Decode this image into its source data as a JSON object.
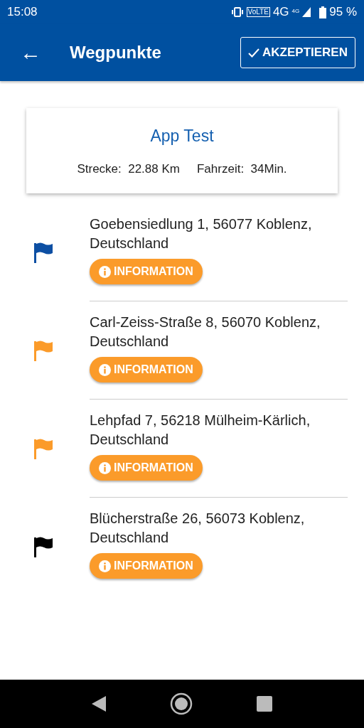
{
  "status_bar": {
    "time": "15:08",
    "network_badge": "VoLTE",
    "network_type": "4G",
    "signal_type": "4G",
    "battery": "95 %"
  },
  "app_bar": {
    "back": "←",
    "title": "Wegpunkte",
    "accept_button": "AKZEPTIEREN"
  },
  "summary": {
    "title": "App Test",
    "distance_label": "Strecke:",
    "distance": "22.88 Km",
    "duration_label": "Fahrzeit:",
    "duration": "34Min."
  },
  "waypoints": [
    {
      "address": "Goebensiedlung 1, 56077 Koblenz, Deutschland",
      "color": "#0d4fa3",
      "button": "INFORMATION"
    },
    {
      "address": "Carl-Zeiss-Straße 8, 56070 Koblenz, Deutschland",
      "color": "#fb9b2a",
      "button": "INFORMATION"
    },
    {
      "address": "Lehpfad 7, 56218 Mülheim-Kärlich, Deutschland",
      "color": "#fb9b2a",
      "button": "INFORMATION"
    },
    {
      "address": "Blücherstraße 26, 56073 Koblenz, Deutschland",
      "color": "#000000",
      "button": "INFORMATION"
    }
  ]
}
